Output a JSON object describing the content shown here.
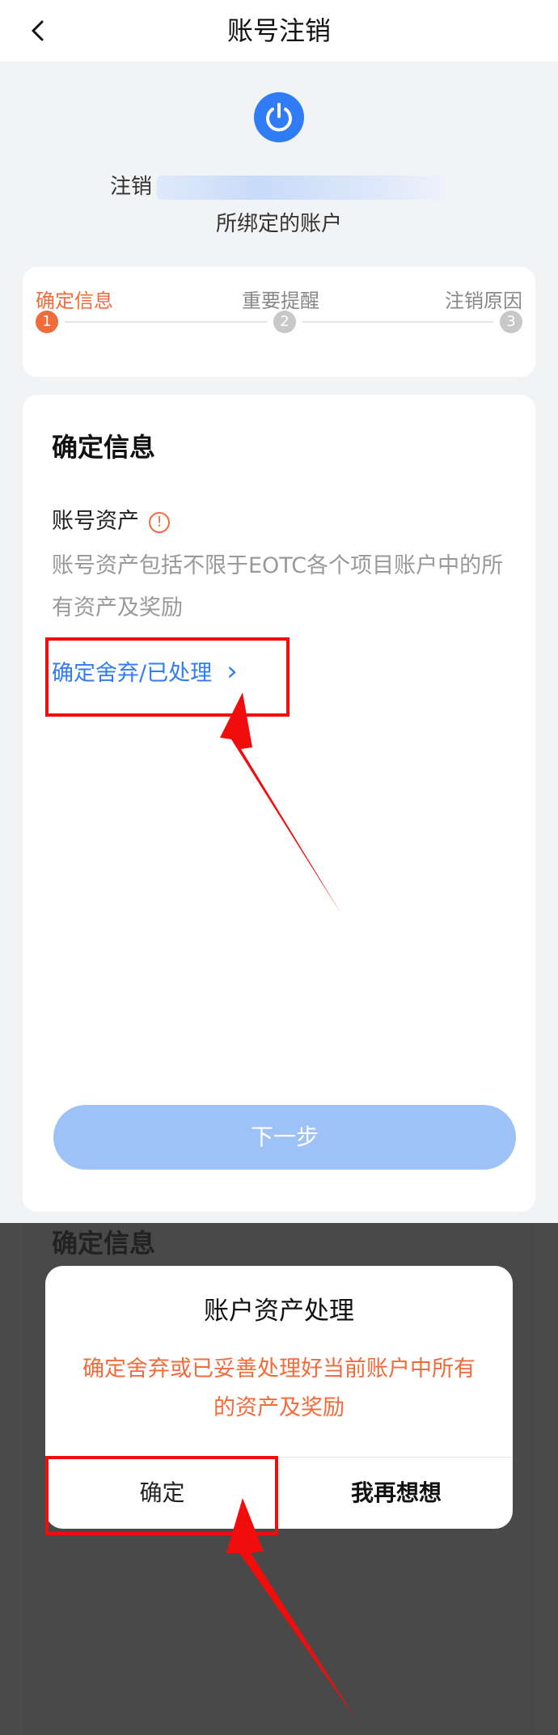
{
  "header": {
    "title": "账号注销"
  },
  "account": {
    "cancel_prefix": "注销",
    "bound_text": "所绑定的账户"
  },
  "steps": [
    {
      "label": "确定信息",
      "number": "1"
    },
    {
      "label": "重要提醒",
      "number": "2"
    },
    {
      "label": "注销原因",
      "number": "3"
    }
  ],
  "info": {
    "title": "确定信息",
    "asset_title": "账号资产",
    "warn_glyph": "!",
    "asset_desc": "账号资产包括不限于EOTC各个项目账户中的所有资产及奖励",
    "confirm_link": "确定舍弃/已处理",
    "chevron": "›",
    "next_button": "下一步"
  },
  "dialog": {
    "bg_heading": "确定信息",
    "title": "账户资产处理",
    "message": "确定舍弃或已妥善处理好当前账户中所有的资产及奖励",
    "confirm": "确定",
    "rethink": "我再想想"
  },
  "colors": {
    "accent": "#2f7cf6",
    "warning": "#f26b3a",
    "highlight": "#f20d0d"
  }
}
